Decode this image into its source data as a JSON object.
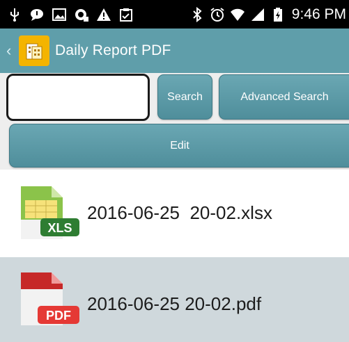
{
  "status_bar": {
    "time": "9:46 PM",
    "icons": [
      "usb-icon",
      "chat-icon",
      "image-icon",
      "camera-icon",
      "warning-icon",
      "clipboard-icon",
      "bluetooth-icon",
      "alarm-icon",
      "wifi-icon",
      "signal-icon",
      "battery-icon"
    ]
  },
  "app_bar": {
    "title": "Daily Report PDF",
    "back_icon": "chevron-left-icon",
    "app_icon": "report-building-icon"
  },
  "toolbar": {
    "search_value": "",
    "search_label": "Search",
    "advanced_search_label": "Advanced Search",
    "edit_label": "Edit"
  },
  "files": [
    {
      "name": "2016-06-25  20-02.xlsx",
      "type_label": "XLS",
      "color": "#2e8b3d",
      "icon": "xls-file-icon"
    },
    {
      "name": "2016-06-25 20-02.pdf",
      "type_label": "PDF",
      "color": "#d9302c",
      "icon": "pdf-file-icon"
    }
  ],
  "colors": {
    "accent": "#5f9eaa",
    "selected_row": "#cfd8dc"
  }
}
